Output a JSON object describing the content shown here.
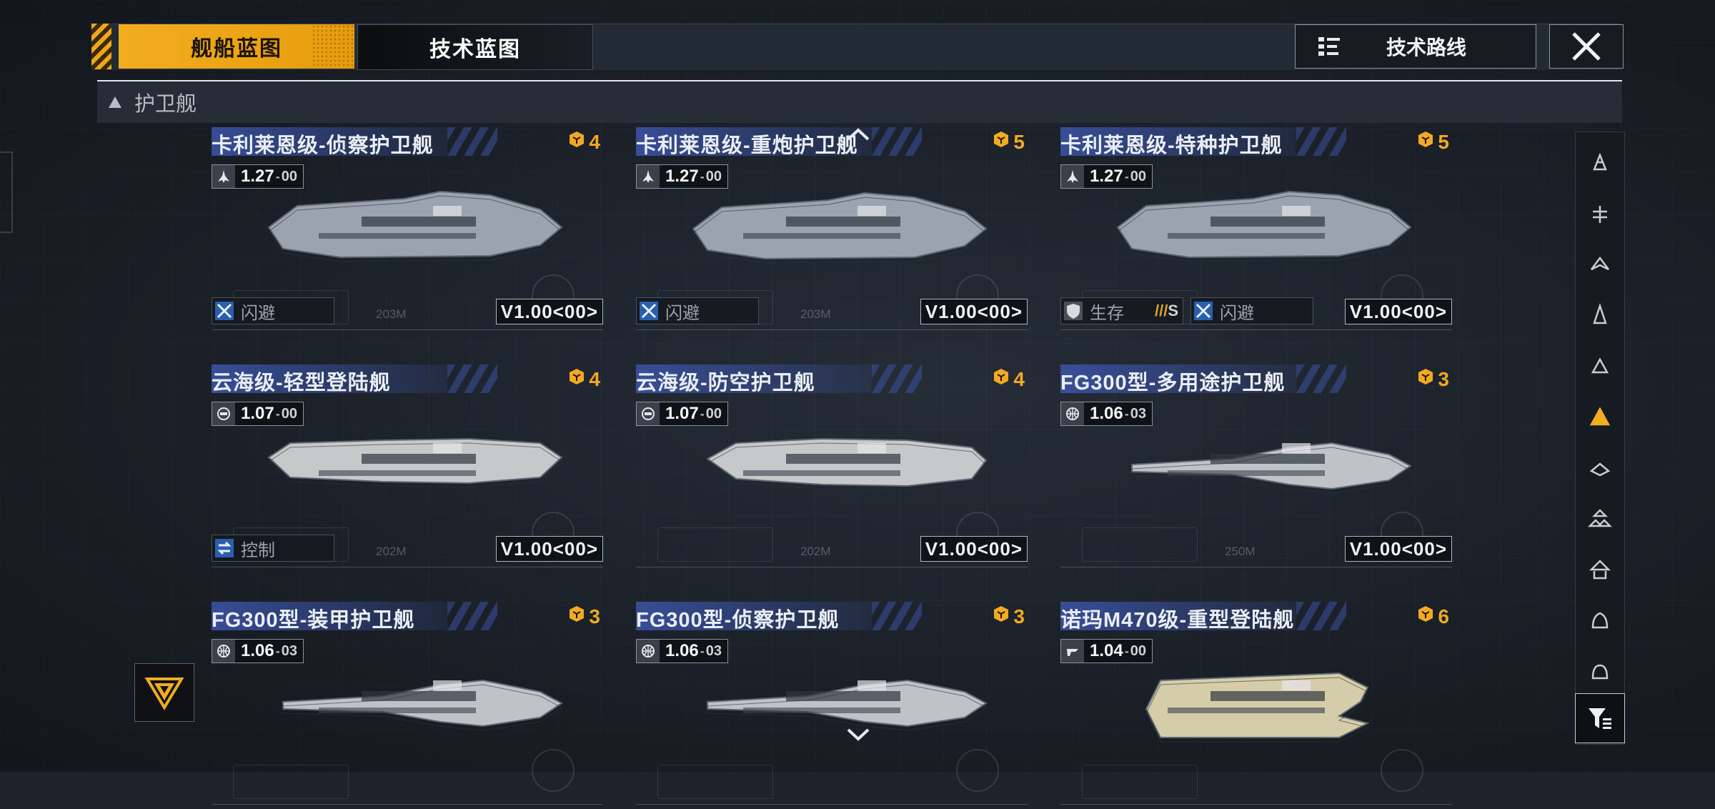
{
  "tabs": [
    {
      "label": "舰船蓝图",
      "active": true
    },
    {
      "label": "技术蓝图",
      "active": false
    }
  ],
  "tech_route": {
    "label": "技术路线",
    "icon": "tree-icon"
  },
  "close": {
    "icon": "close-icon"
  },
  "category": {
    "label": "护卫舰",
    "icon": "collapse-triangle-icon"
  },
  "ships": [
    {
      "name": "卡利莱恩级-侦察护卫舰",
      "cost": "4",
      "version": "1.27",
      "version_sub": "00",
      "ver_icon": "ship-class-icon",
      "tags": [
        {
          "icon": "evade-icon",
          "label": "闪避"
        }
      ],
      "code": "V1.00<00>",
      "length": "203M",
      "color": "#9aa3ae"
    },
    {
      "name": "卡利莱恩级-重炮护卫舰",
      "cost": "5",
      "version": "1.27",
      "version_sub": "00",
      "ver_icon": "ship-class-icon",
      "tags": [
        {
          "icon": "evade-icon",
          "label": "闪避"
        }
      ],
      "code": "V1.00<00>",
      "length": "203M",
      "color": "#9aa3ae"
    },
    {
      "name": "卡利莱恩级-特种护卫舰",
      "cost": "5",
      "version": "1.27",
      "version_sub": "00",
      "ver_icon": "ship-class-icon",
      "tags": [
        {
          "icon": "shield-icon",
          "label": "生存",
          "rank": "S",
          "rank_prefix": "///"
        },
        {
          "icon": "evade-icon",
          "label": "闪避"
        }
      ],
      "code": "V1.00<00>",
      "length": "",
      "color": "#9aa3ae"
    },
    {
      "name": "云海级-轻型登陆舰",
      "cost": "4",
      "version": "1.07",
      "version_sub": "00",
      "ver_icon": "gear-globe-icon",
      "tags": [
        {
          "icon": "control-icon",
          "label": "控制"
        }
      ],
      "code": "V1.00<00>",
      "length": "202M",
      "color": "#c6c8ca"
    },
    {
      "name": "云海级-防空护卫舰",
      "cost": "4",
      "version": "1.07",
      "version_sub": "00",
      "ver_icon": "gear-globe-icon",
      "tags": [],
      "code": "V1.00<00>",
      "length": "202M",
      "color": "#c6c8ca"
    },
    {
      "name": "FG300型-多用途护卫舰",
      "cost": "3",
      "version": "1.06",
      "version_sub": "03",
      "ver_icon": "globe-icon",
      "tags": [],
      "code": "V1.00<00>",
      "length": "250M",
      "color": "#bfc3c8"
    },
    {
      "name": "FG300型-装甲护卫舰",
      "cost": "3",
      "version": "1.06",
      "version_sub": "03",
      "ver_icon": "globe-icon",
      "tags": [],
      "code": "",
      "length": "",
      "color": "#bfc3c8"
    },
    {
      "name": "FG300型-侦察护卫舰",
      "cost": "3",
      "version": "1.06",
      "version_sub": "03",
      "ver_icon": "globe-icon",
      "tags": [],
      "code": "",
      "length": "",
      "color": "#bfc3c8"
    },
    {
      "name": "诺玛M470级-重型登陆舰",
      "cost": "6",
      "version": "1.04",
      "version_sub": "00",
      "ver_icon": "faction-icon",
      "tags": [],
      "code": "",
      "length": "",
      "color": "#d5ccaa"
    }
  ],
  "sidebar": [
    {
      "icon": "battleship-icon",
      "active": false
    },
    {
      "icon": "carrier-icon",
      "active": false
    },
    {
      "icon": "cruiser-icon",
      "active": false
    },
    {
      "icon": "destroyer-icon",
      "active": false
    },
    {
      "icon": "frigate-icon",
      "active": false
    },
    {
      "icon": "corvette-icon",
      "active": true
    },
    {
      "icon": "fighter-icon",
      "active": false
    },
    {
      "icon": "squadron-icon",
      "active": false
    },
    {
      "icon": "support-icon",
      "active": false
    },
    {
      "icon": "auxiliary-icon",
      "active": false
    },
    {
      "icon": "station-icon",
      "active": false
    }
  ],
  "filter": {
    "icon": "filter-icon"
  },
  "emblem": {
    "icon": "triangle-emblem-icon"
  },
  "accent_color": "#f2ad1f",
  "active_color": "#f2ad1f"
}
